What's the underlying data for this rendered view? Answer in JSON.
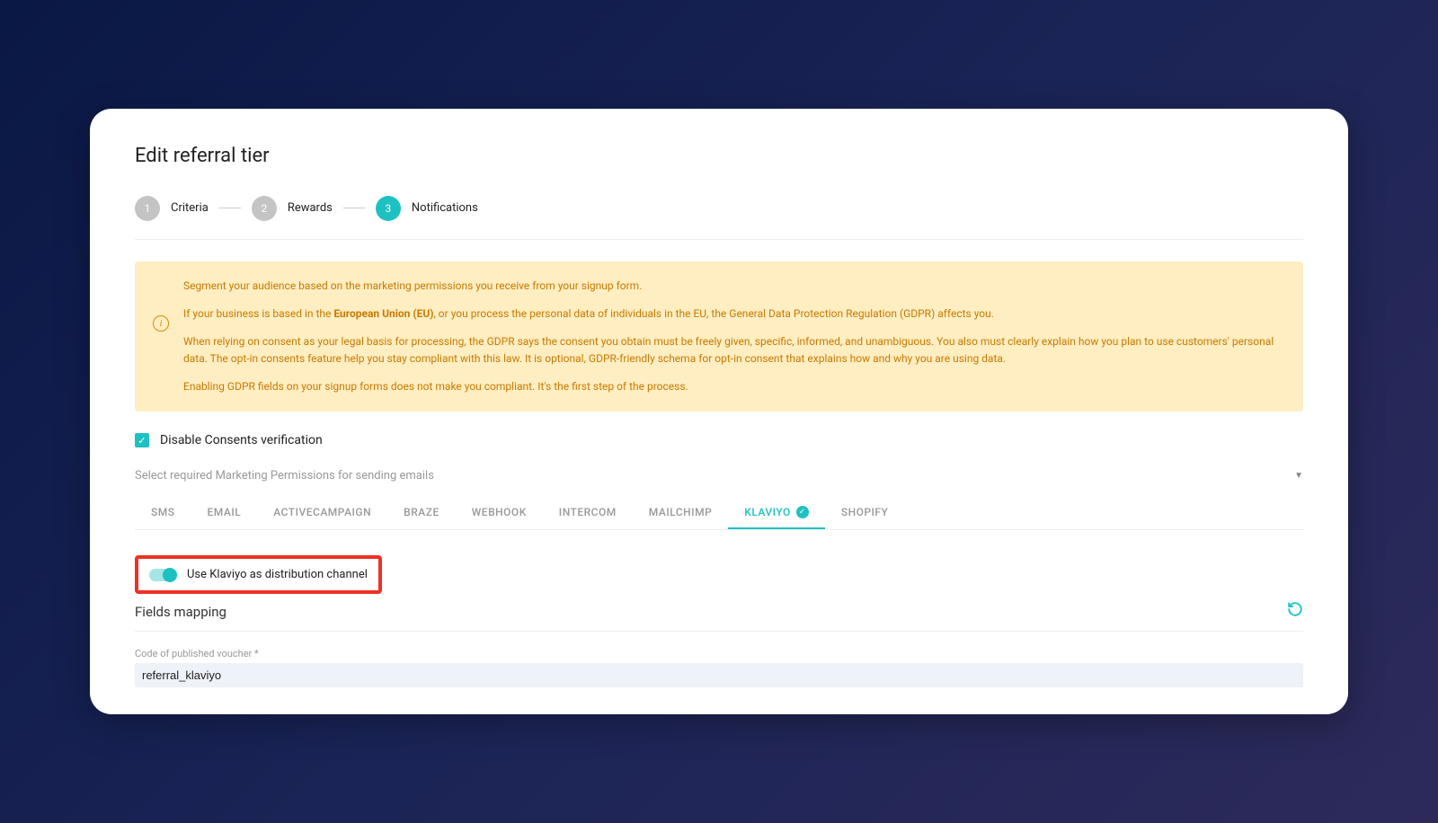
{
  "page": {
    "title": "Edit referral tier"
  },
  "stepper": {
    "steps": [
      {
        "num": "1",
        "label": "Criteria",
        "active": false
      },
      {
        "num": "2",
        "label": "Rewards",
        "active": false
      },
      {
        "num": "3",
        "label": "Notifications",
        "active": true
      }
    ]
  },
  "alert": {
    "p1": "Segment your audience based on the marketing permissions you receive from your signup form.",
    "p2_pre": "If your business is based in the ",
    "p2_bold": "European Union (EU)",
    "p2_post": ", or you process the personal data of individuals in the EU, the General Data Protection Regulation (GDPR) affects you.",
    "p3": "When relying on consent as your legal basis for processing, the GDPR says the consent you obtain must be freely given, specific, informed, and unambiguous. You also must clearly explain how you plan to use customers' personal data. The opt-in consents feature help you stay compliant with this law. It is optional, GDPR-friendly schema for opt-in consent that explains how and why you are using data.",
    "p4": "Enabling GDPR fields on your signup forms does not make you compliant. It's the first step of the process."
  },
  "checkbox": {
    "label": "Disable Consents verification",
    "checked": true
  },
  "select": {
    "placeholder": "Select required Marketing Permissions for sending emails"
  },
  "tabs": {
    "items": [
      {
        "label": "SMS",
        "active": false,
        "badge": false
      },
      {
        "label": "EMAIL",
        "active": false,
        "badge": false
      },
      {
        "label": "ACTIVECAMPAIGN",
        "active": false,
        "badge": false
      },
      {
        "label": "BRAZE",
        "active": false,
        "badge": false
      },
      {
        "label": "WEBHOOK",
        "active": false,
        "badge": false
      },
      {
        "label": "INTERCOM",
        "active": false,
        "badge": false
      },
      {
        "label": "MAILCHIMP",
        "active": false,
        "badge": false
      },
      {
        "label": "KLAVIYO",
        "active": true,
        "badge": true
      },
      {
        "label": "SHOPIFY",
        "active": false,
        "badge": false
      }
    ]
  },
  "toggle": {
    "label": "Use Klaviyo as distribution channel",
    "on": true
  },
  "section": {
    "title": "Fields mapping"
  },
  "field": {
    "label": "Code of published voucher *",
    "value": "referral_klaviyo"
  }
}
